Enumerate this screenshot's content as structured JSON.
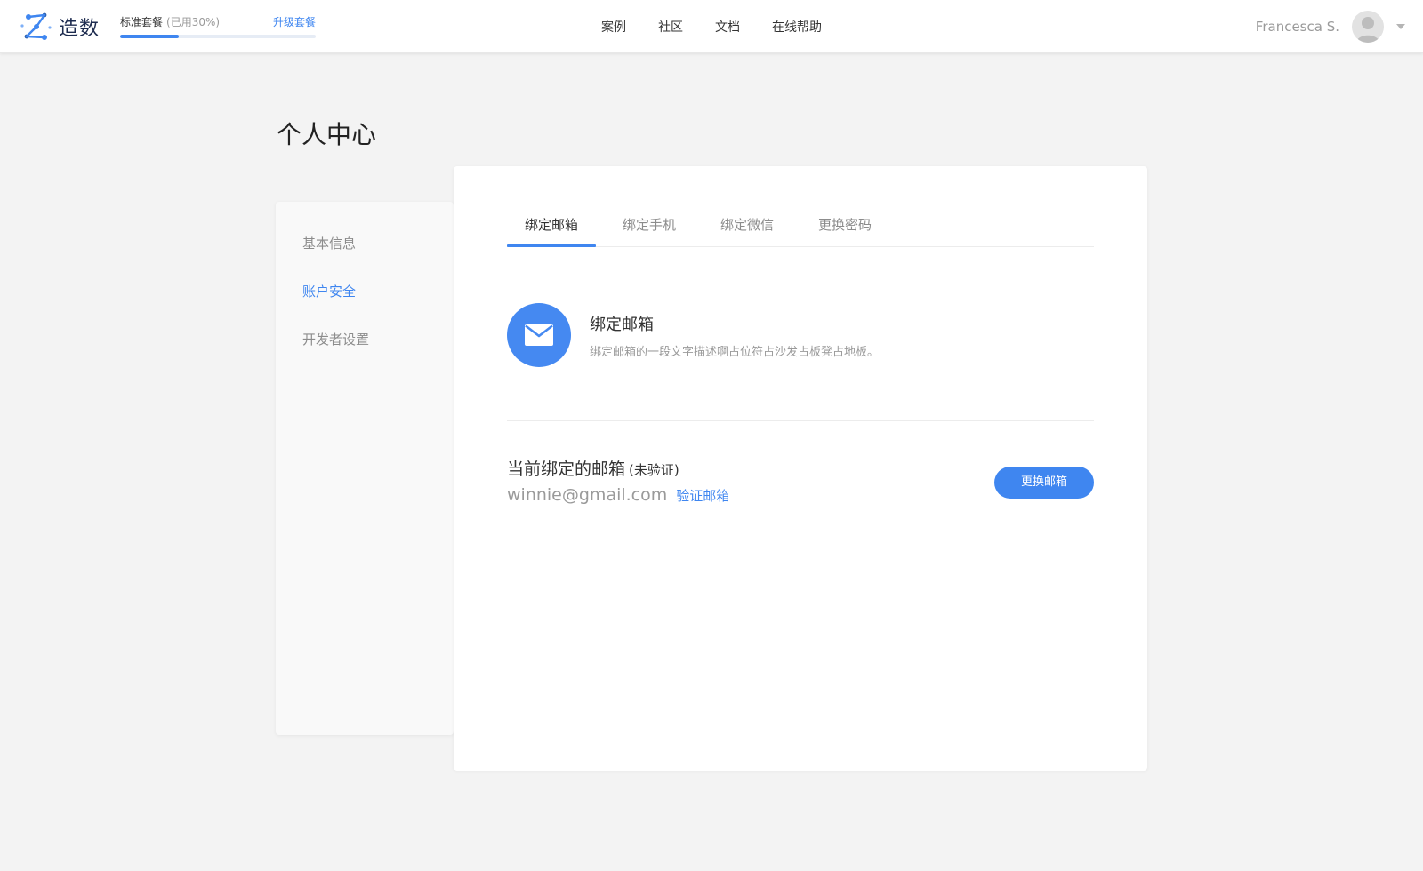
{
  "brand": {
    "name": "造数"
  },
  "plan": {
    "name": "标准套餐",
    "usage": "(已用30%)",
    "upgrade_label": "升级套餐",
    "used_fraction": 0.3
  },
  "nav": {
    "items": [
      "案例",
      "社区",
      "文档",
      "在线帮助"
    ]
  },
  "user": {
    "name": "Francesca S."
  },
  "page": {
    "title": "个人中心"
  },
  "sidebar": {
    "items": [
      {
        "label": "基本信息",
        "active": false
      },
      {
        "label": "账户安全",
        "active": true
      },
      {
        "label": "开发者设置",
        "active": false
      }
    ]
  },
  "tabs": {
    "items": [
      {
        "label": "绑定邮箱",
        "active": true
      },
      {
        "label": "绑定手机",
        "active": false
      },
      {
        "label": "绑定微信",
        "active": false
      },
      {
        "label": "更换密码",
        "active": false
      }
    ]
  },
  "email_section": {
    "title": "绑定邮箱",
    "description": "绑定邮箱的一段文字描述啊占位符占沙发占板凳占地板。",
    "current_title": "当前绑定的邮箱",
    "current_status": "(未验证)",
    "email": "winnie@gmail.com",
    "verify_label": "验证邮箱",
    "change_label": "更换邮箱"
  },
  "colors": {
    "accent": "#3f86f0",
    "background": "#f3f3f3"
  },
  "icons": {
    "logo": "logo-mark",
    "mail": "mail-icon",
    "avatar": "avatar-icon",
    "caret": "chevron-down-icon"
  }
}
